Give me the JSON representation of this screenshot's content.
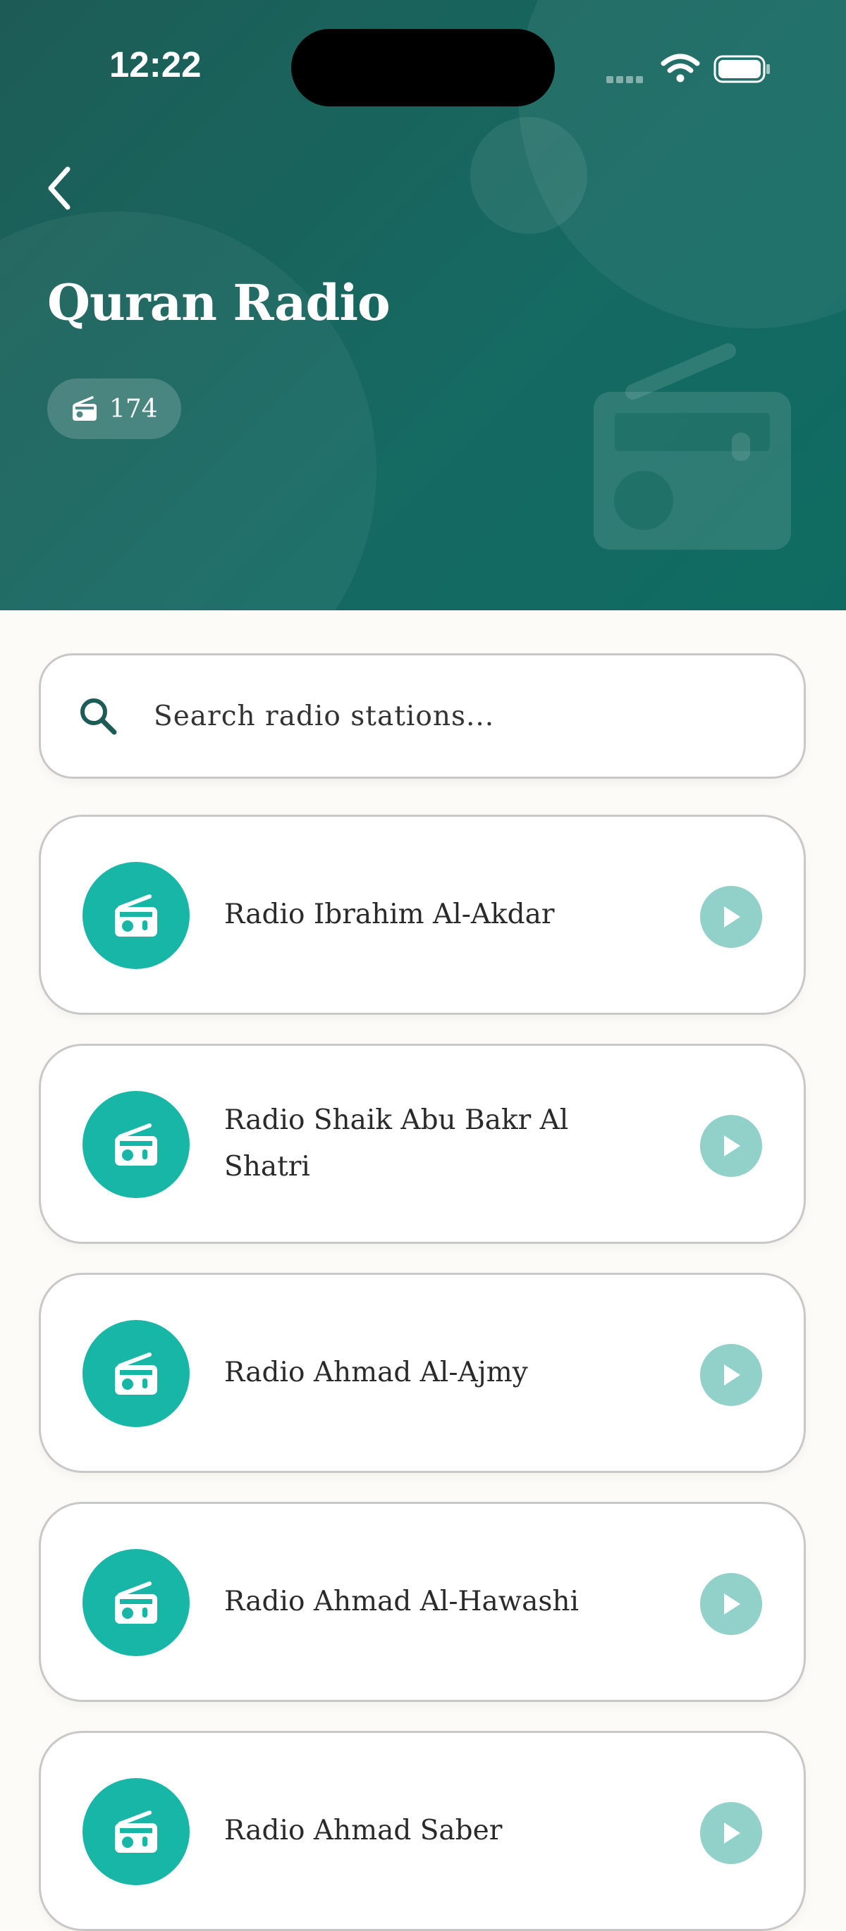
{
  "status_bar": {
    "time": "12:22"
  },
  "header": {
    "title": "Quran Radio",
    "station_count": "174"
  },
  "search": {
    "placeholder": "Search radio stations..."
  },
  "stations": [
    {
      "name": "Radio Ibrahim Al-Akdar"
    },
    {
      "name": "Radio Shaik Abu Bakr Al Shatri"
    },
    {
      "name": "Radio Ahmad Al-Ajmy"
    },
    {
      "name": "Radio Ahmad Al-Hawashi"
    },
    {
      "name": "Radio Ahmad Saber"
    }
  ],
  "colors": {
    "header": "#156a62",
    "accent": "#17b6a6",
    "play_button": "#91d1c9",
    "background": "#fcfbf7"
  }
}
